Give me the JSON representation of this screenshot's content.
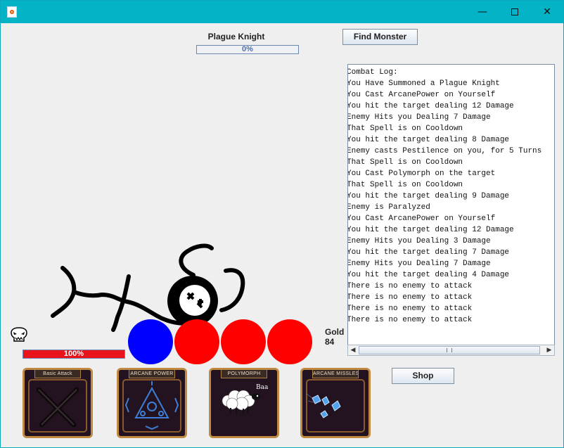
{
  "window": {
    "minimize": "—",
    "close": "✕"
  },
  "monster": {
    "name": "Plague Knight",
    "progress_text": "0%",
    "progress_fraction": 0.0
  },
  "buttons": {
    "find_monster": "Find Monster",
    "shop": "Shop"
  },
  "combat_log": {
    "lines": [
      "Combat Log:",
      "You Have Summoned a Plague Knight",
      "You Cast ArcanePower on Yourself",
      "You hit the target dealing 12 Damage",
      "Enemy Hits you Dealing 7 Damage",
      "That Spell is on Cooldown",
      "You hit the target dealing 8 Damage",
      "Enemy casts Pestilence on you, for 5 Turns",
      "That Spell is on Cooldown",
      "You Cast Polymorph on the target",
      "That Spell is on Cooldown",
      "You hit the target dealing 9 Damage",
      "Enemy is Paralyzed",
      "You Cast ArcanePower on Yourself",
      "You hit the target dealing 12 Damage",
      "Enemy Hits you Dealing 3 Damage",
      "You hit the target dealing 7 Damage",
      "Enemy Hits you Dealing 7 Damage",
      "You hit the target dealing 4 Damage",
      "There is no enemy to attack",
      "There is no enemy to attack",
      "There is no enemy to attack",
      "There is no enemy to attack"
    ]
  },
  "orbs": [
    {
      "color": "#0000ff"
    },
    {
      "color": "#ff0000"
    },
    {
      "color": "#ff0000"
    },
    {
      "color": "#ff0000"
    }
  ],
  "gold": {
    "label": "Gold",
    "value": "84"
  },
  "player": {
    "health_text": "100%",
    "health_fraction": 1.0,
    "icon": "skull-icon"
  },
  "spells": [
    {
      "label": "Basic Attack",
      "icon": "crossed-swords-icon"
    },
    {
      "label": "ARCANE POWER",
      "icon": "arcane-triangle-icon"
    },
    {
      "label": "POLYMORPH",
      "icon": "sheep-icon",
      "caption": "Baa"
    },
    {
      "label": "ARCANE MISSLES",
      "icon": "arcane-missiles-icon"
    }
  ],
  "colors": {
    "titlebar": "#05b3c6",
    "health": "#e8131b",
    "frame": "#c08a42"
  }
}
